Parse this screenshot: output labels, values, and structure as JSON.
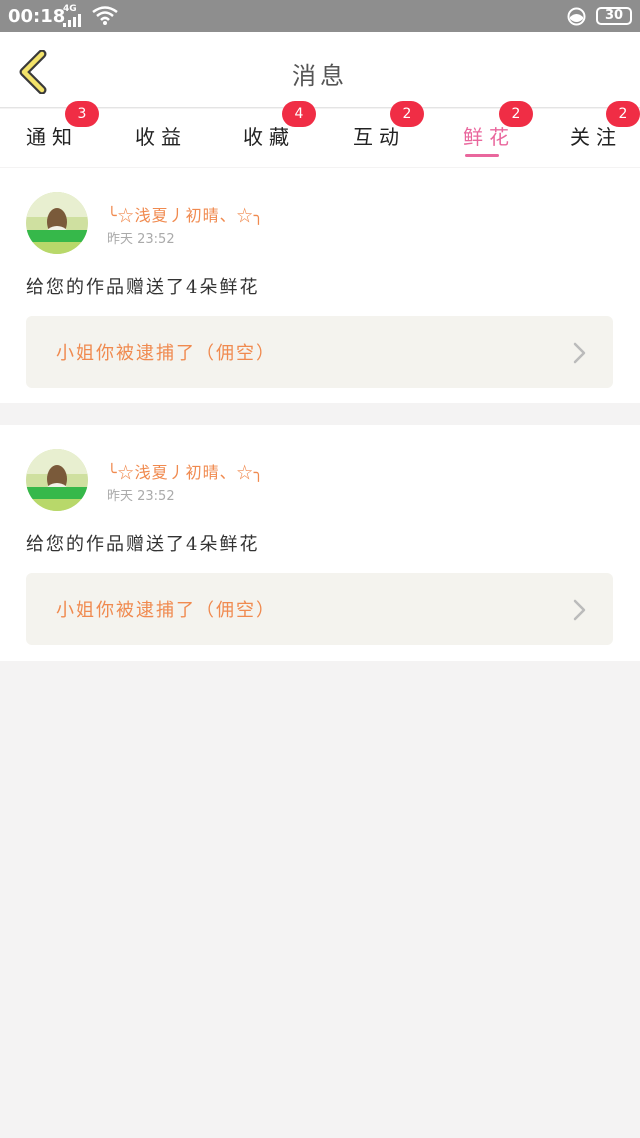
{
  "status_bar": {
    "time": "00:18",
    "network": "4G",
    "battery": "30"
  },
  "header": {
    "title": "消息",
    "back_icon": "chevron-left-icon"
  },
  "tabs": [
    {
      "label": "通知",
      "badge": "3",
      "active": false
    },
    {
      "label": "收益",
      "badge": "",
      "active": false
    },
    {
      "label": "收藏",
      "badge": "4",
      "active": false
    },
    {
      "label": "互动",
      "badge": "2",
      "active": false
    },
    {
      "label": "鲜花",
      "badge": "2",
      "active": true
    },
    {
      "label": "关注",
      "badge": "2",
      "active": false
    }
  ],
  "messages": [
    {
      "username": "╰☆浅夏丿初晴、☆╮",
      "time": "昨天 23:52",
      "text": "给您的作品赠送了4朵鲜花",
      "work_title": "小姐你被逮捕了（佣空）"
    },
    {
      "username": "╰☆浅夏丿初晴、☆╮",
      "time": "昨天 23:52",
      "text": "给您的作品赠送了4朵鲜花",
      "work_title": "小姐你被逮捕了（佣空）"
    }
  ],
  "colors": {
    "accent": "#e9679d",
    "badge": "#f02d45",
    "username": "#f08a4f",
    "status_bar": "#8e8e8e"
  }
}
